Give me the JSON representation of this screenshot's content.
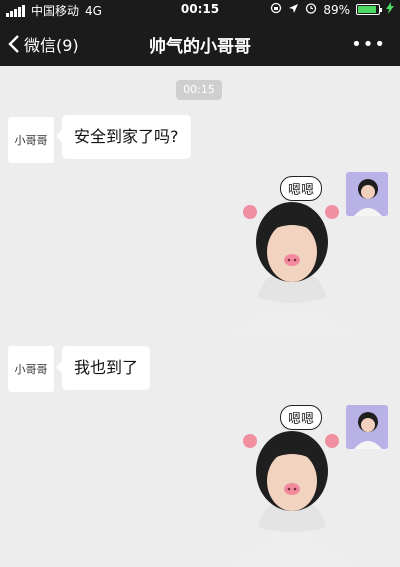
{
  "status_bar": {
    "carrier": "中国移动",
    "network": "4G",
    "time": "00:15",
    "battery": "89%",
    "battery_level": 0.89
  },
  "nav": {
    "back_label": "微信(9)",
    "title": "帅气的小哥哥",
    "more": "•••"
  },
  "chat": {
    "timestamp": "00:15",
    "messages": [
      {
        "side": "left",
        "avatar_text": "小哥哥",
        "text": "安全到家了吗?"
      },
      {
        "side": "right",
        "type": "sticker",
        "caption": "嗯嗯"
      },
      {
        "side": "left",
        "avatar_text": "小哥哥",
        "text": "我也到了"
      },
      {
        "side": "right",
        "type": "sticker",
        "caption": "嗯嗯"
      }
    ]
  },
  "colors": {
    "bar_bg": "#1b1b1b",
    "chat_bg": "#ededed",
    "battery_fill": "#4cd964"
  }
}
